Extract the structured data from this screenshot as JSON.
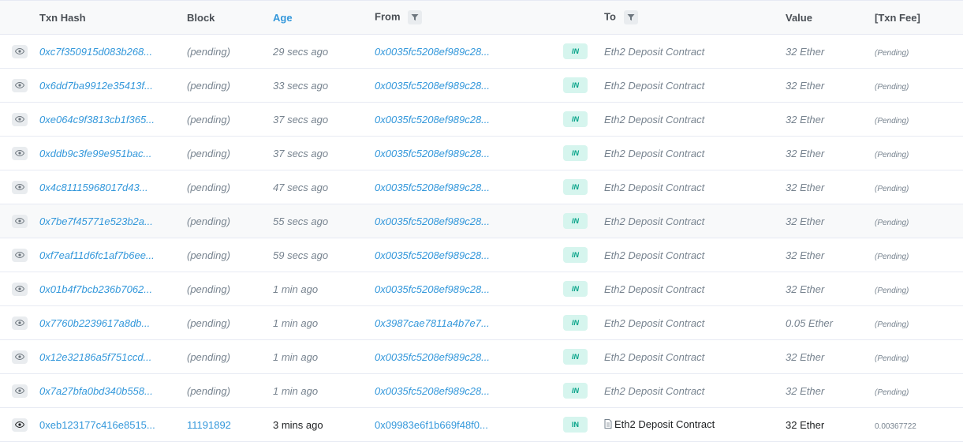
{
  "headers": {
    "txn_hash": "Txn Hash",
    "block": "Block",
    "age": "Age",
    "from": "From",
    "to": "To",
    "value": "Value",
    "fee": "[Txn Fee]"
  },
  "colors": {
    "link": "#3498db",
    "badge_bg": "#d6f5ee",
    "badge_text": "#00a186"
  },
  "icons": {
    "view": "eye-icon",
    "filter": "filter-icon",
    "contract": "document-icon"
  },
  "rows": [
    {
      "hash": "0xc7f350915d083b268...",
      "block": "(pending)",
      "age": "29 secs ago",
      "from": "0x0035fc5208ef989c28...",
      "dir": "IN",
      "to": "Eth2 Deposit Contract",
      "value": "32 Ether",
      "fee": "(Pending)"
    },
    {
      "hash": "0x6dd7ba9912e35413f...",
      "block": "(pending)",
      "age": "33 secs ago",
      "from": "0x0035fc5208ef989c28...",
      "dir": "IN",
      "to": "Eth2 Deposit Contract",
      "value": "32 Ether",
      "fee": "(Pending)"
    },
    {
      "hash": "0xe064c9f3813cb1f365...",
      "block": "(pending)",
      "age": "37 secs ago",
      "from": "0x0035fc5208ef989c28...",
      "dir": "IN",
      "to": "Eth2 Deposit Contract",
      "value": "32 Ether",
      "fee": "(Pending)"
    },
    {
      "hash": "0xddb9c3fe99e951bac...",
      "block": "(pending)",
      "age": "37 secs ago",
      "from": "0x0035fc5208ef989c28...",
      "dir": "IN",
      "to": "Eth2 Deposit Contract",
      "value": "32 Ether",
      "fee": "(Pending)"
    },
    {
      "hash": "0x4c81115968017d43...",
      "block": "(pending)",
      "age": "47 secs ago",
      "from": "0x0035fc5208ef989c28...",
      "dir": "IN",
      "to": "Eth2 Deposit Contract",
      "value": "32 Ether",
      "fee": "(Pending)"
    },
    {
      "hash": "0x7be7f45771e523b2a...",
      "block": "(pending)",
      "age": "55 secs ago",
      "from": "0x0035fc5208ef989c28...",
      "dir": "IN",
      "to": "Eth2 Deposit Contract",
      "value": "32 Ether",
      "fee": "(Pending)"
    },
    {
      "hash": "0xf7eaf11d6fc1af7b6ee...",
      "block": "(pending)",
      "age": "59 secs ago",
      "from": "0x0035fc5208ef989c28...",
      "dir": "IN",
      "to": "Eth2 Deposit Contract",
      "value": "32 Ether",
      "fee": "(Pending)"
    },
    {
      "hash": "0x01b4f7bcb236b7062...",
      "block": "(pending)",
      "age": "1 min ago",
      "from": "0x0035fc5208ef989c28...",
      "dir": "IN",
      "to": "Eth2 Deposit Contract",
      "value": "32 Ether",
      "fee": "(Pending)"
    },
    {
      "hash": "0x7760b2239617a8db...",
      "block": "(pending)",
      "age": "1 min ago",
      "from": "0x3987cae7811a4b7e7...",
      "dir": "IN",
      "to": "Eth2 Deposit Contract",
      "value": "0.05 Ether",
      "fee": "(Pending)"
    },
    {
      "hash": "0x12e32186a5f751ccd...",
      "block": "(pending)",
      "age": "1 min ago",
      "from": "0x0035fc5208ef989c28...",
      "dir": "IN",
      "to": "Eth2 Deposit Contract",
      "value": "32 Ether",
      "fee": "(Pending)"
    },
    {
      "hash": "0x7a27bfa0bd340b558...",
      "block": "(pending)",
      "age": "1 min ago",
      "from": "0x0035fc5208ef989c28...",
      "dir": "IN",
      "to": "Eth2 Deposit Contract",
      "value": "32 Ether",
      "fee": "(Pending)"
    },
    {
      "hash": "0xeb123177c416e8515...",
      "block": "11191892",
      "age": "3 mins ago",
      "from": "0x09983e6f1b669f48f0...",
      "dir": "IN",
      "to": "Eth2 Deposit Contract",
      "value": "32 Ether",
      "fee": "0.00367722"
    }
  ]
}
